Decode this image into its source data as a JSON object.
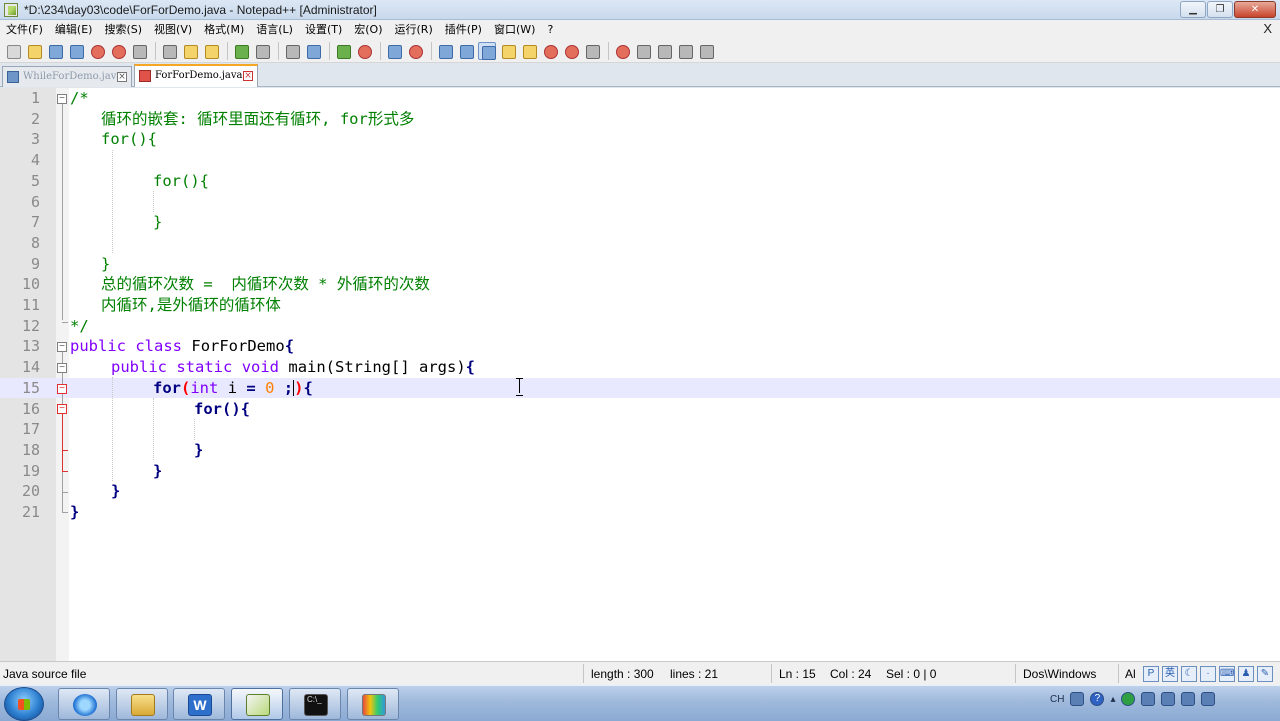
{
  "window": {
    "title": "*D:\\234\\day03\\code\\ForForDemo.java - Notepad++ [Administrator]",
    "controls": [
      "▁",
      "❐",
      "✕"
    ]
  },
  "menu": {
    "items": [
      "文件(F)",
      "编辑(E)",
      "搜索(S)",
      "视图(V)",
      "格式(M)",
      "语言(L)",
      "设置(T)",
      "宏(O)",
      "运行(R)",
      "插件(P)",
      "窗口(W)",
      "?"
    ],
    "close_doc": "X"
  },
  "tabs": [
    {
      "label": "WhileForDemo.java",
      "active": false
    },
    {
      "label": "ForForDemo.java",
      "active": true
    }
  ],
  "editor": {
    "line_numbers": [
      "1",
      "2",
      "3",
      "4",
      "5",
      "6",
      "7",
      "8",
      "9",
      "10",
      "11",
      "12",
      "13",
      "14",
      "15",
      "16",
      "17",
      "18",
      "19",
      "20",
      "21"
    ],
    "current_line": 15,
    "lines": {
      "l1": "/*",
      "l2": "循环的嵌套: 循环里面还有循环, for形式多",
      "l3": "for(){",
      "l5": "for(){",
      "l7": "}",
      "l9": "}",
      "l10": "总的循环次数 =  内循环次数 * 外循环的次数",
      "l11": "内循环,是外循环的循环体",
      "l12": "*/",
      "l13_kw1": "public",
      "l13_kw2": "class",
      "l13_name": "ForForDemo",
      "l13_brace": "{",
      "l14_kw1": "public",
      "l14_kw2": "static",
      "l14_kw3": "void",
      "l14_rest": "main(String[] args)",
      "l14_brace": "{",
      "l15_for": "for",
      "l15_paren_open": "(",
      "l15_type": "int",
      "l15_var": "i",
      "l15_eq": "=",
      "l15_num": "0",
      "l15_semi": ";",
      "l15_paren_close": ")",
      "l15_brace": "{",
      "l16_for": "for",
      "l16_parens": "()",
      "l16_brace": "{",
      "l18": "}",
      "l19": "}",
      "l20": "}",
      "l21": "}"
    }
  },
  "status": {
    "file_type": "Java source file",
    "length": "length : 300",
    "lines": "lines : 21",
    "ln": "Ln : 15",
    "col": "Col : 24",
    "sel": "Sel : 0 | 0",
    "eol": "Dos\\Windows",
    "encoding": "Al",
    "ime": [
      "P",
      "英"
    ]
  },
  "taskbar": {
    "apps": [
      "ie-icon",
      "folder-icon",
      "word-icon",
      "notepadpp-icon",
      "cmd-icon",
      "paint-icon"
    ],
    "word_glyph": "W",
    "cmd_glyph": "C:\\_",
    "tray_lang": "CH"
  }
}
